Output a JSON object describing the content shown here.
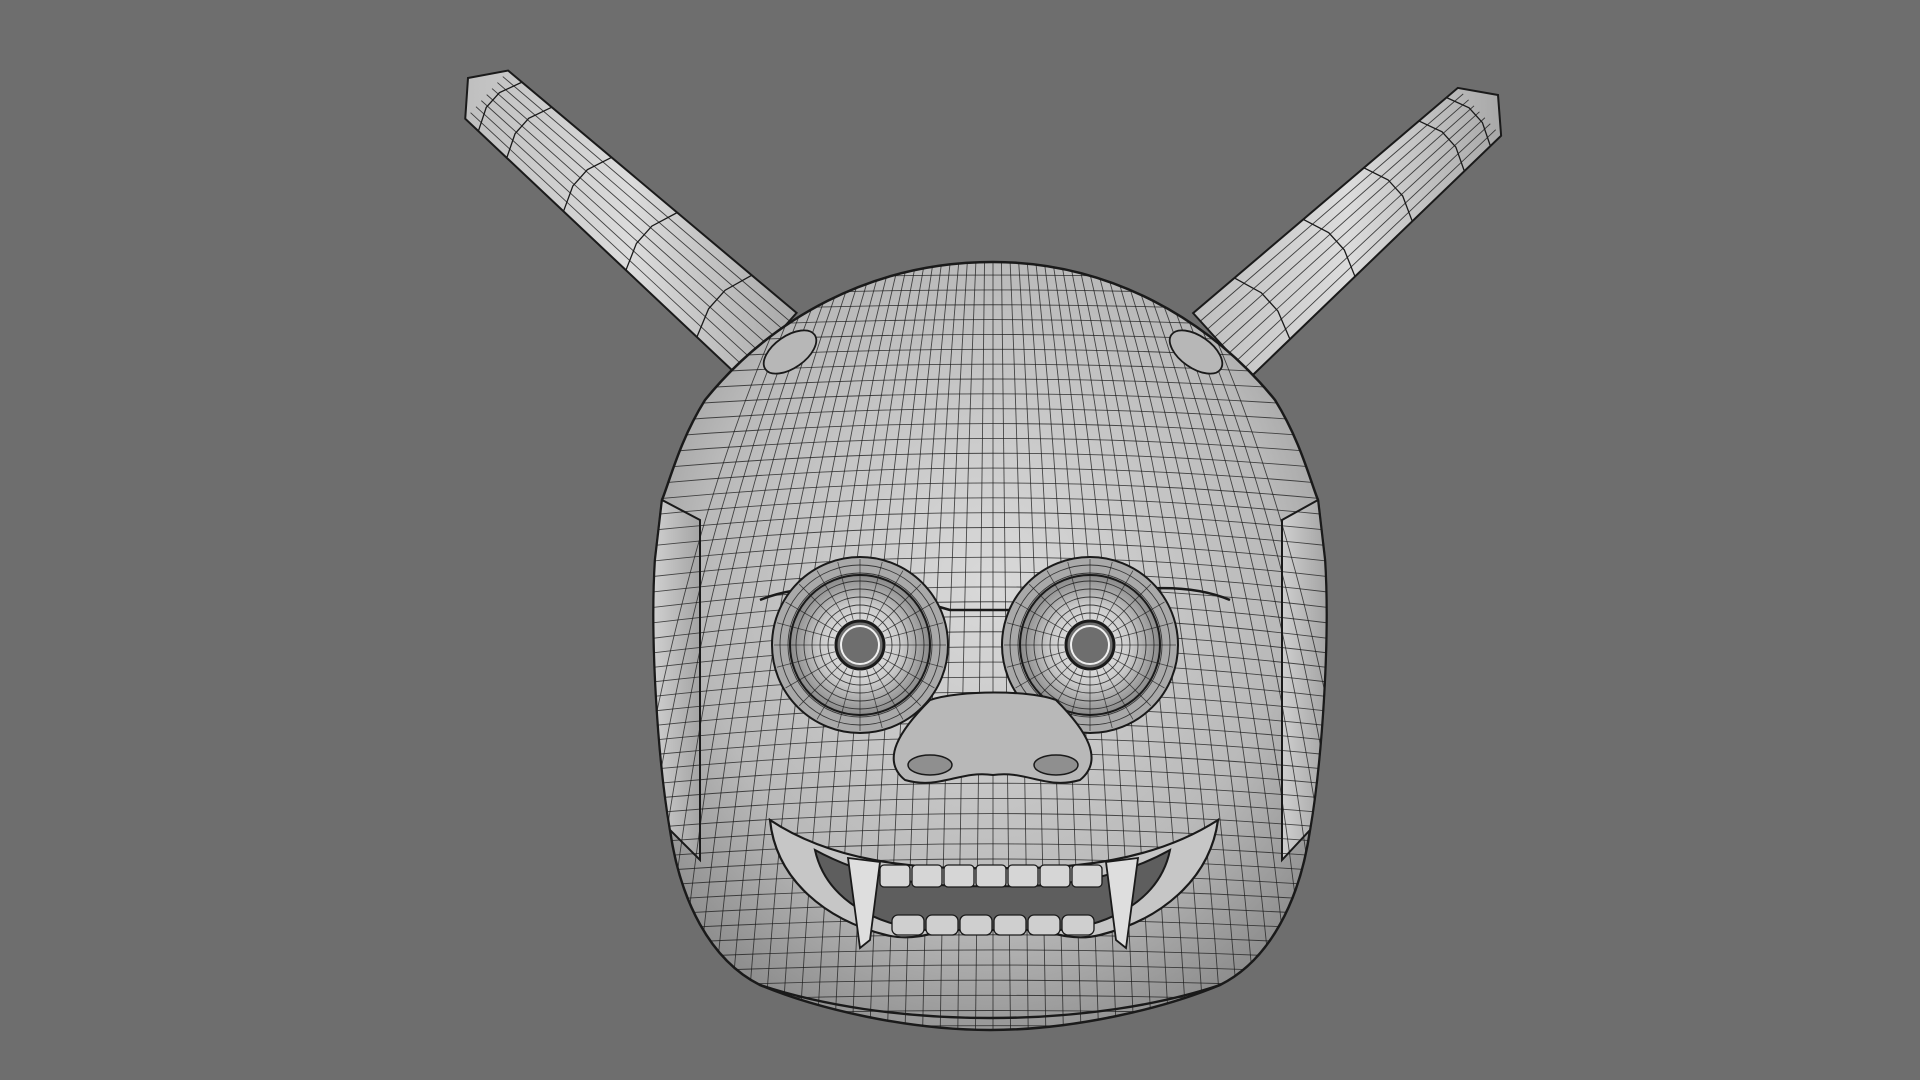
{
  "viewport": {
    "background_color": "#6e6e6e",
    "shading": "solid-with-wireframe",
    "object": {
      "subject": "oni-mask",
      "surface_color": "#cfcfcf",
      "wire_color": "#1a1a1a",
      "parts": [
        "left-horn",
        "right-horn",
        "forehead",
        "left-eye",
        "right-eye",
        "nose",
        "mouth",
        "upper-fangs",
        "lower-teeth",
        "chin",
        "side-flaps"
      ]
    }
  }
}
